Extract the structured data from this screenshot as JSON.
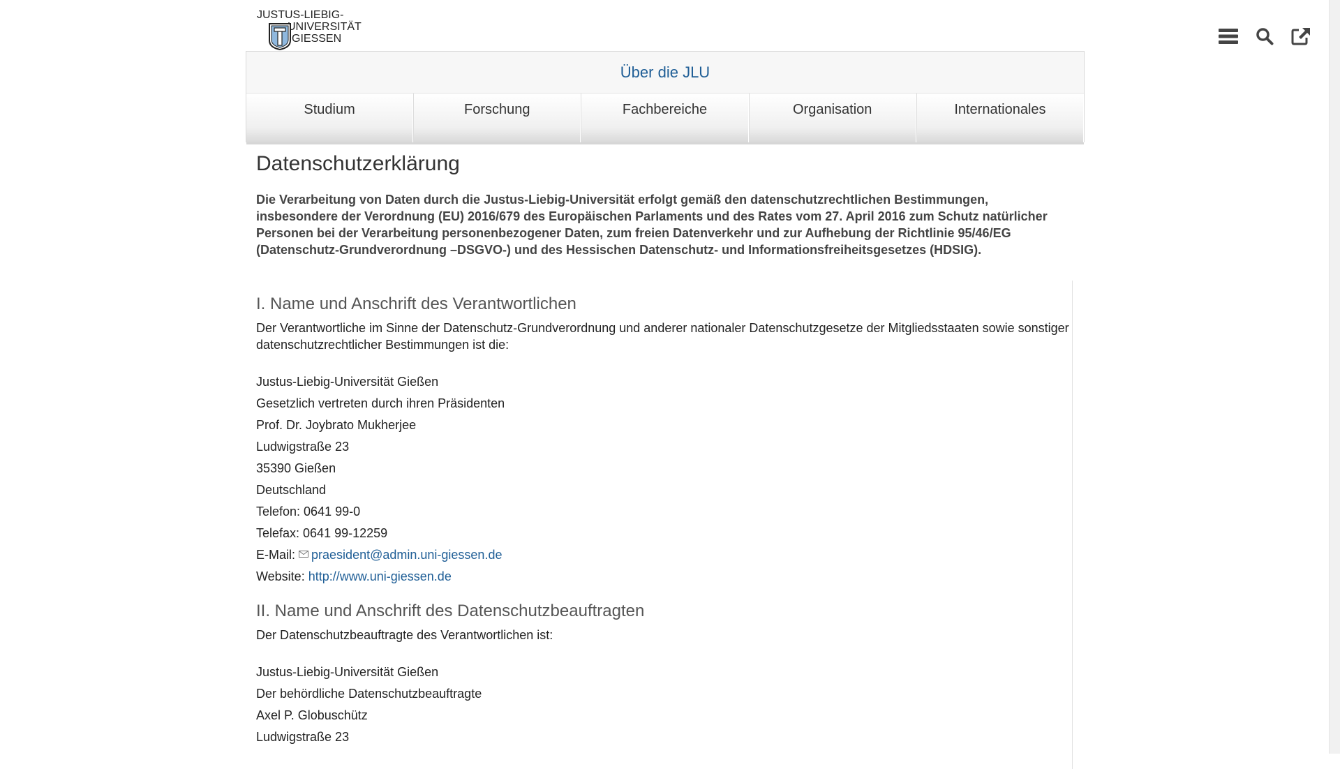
{
  "logo": {
    "line1": "JUSTUS-LIEBIG-",
    "line2": "UNIVERSITÄT",
    "line3": "GIESSEN"
  },
  "header_icons": {
    "menu": "menu-icon",
    "search": "search-icon",
    "external": "external-link-icon"
  },
  "nav": {
    "title": "Über die JLU",
    "tabs": [
      {
        "label": "Studium"
      },
      {
        "label": "Forschung"
      },
      {
        "label": "Fachbereiche"
      },
      {
        "label": "Organisation"
      },
      {
        "label": "Internationales"
      }
    ]
  },
  "page": {
    "title": "Datenschutzerklärung",
    "intro": "Die Verarbeitung von Daten durch die Justus-Liebig-Universität erfolgt gemäß den datenschutzrechtlichen Bestimmungen, insbesondere der Verordnung (EU) 2016/679 des Europäischen Parlaments und des Rates vom 27. April 2016 zum Schutz natürlicher Personen bei der Verarbeitung personenbezogener Daten, zum freien Datenverkehr und zur Aufhebung der Richtlinie 95/46/EG (Datenschutz-Grundverordnung –DSGVO-) und des Hessischen Datenschutz- und Informationsfreiheitsgesetzes (HDSIG)."
  },
  "section1": {
    "heading": "I. Name und Anschrift des Verantwortlichen",
    "text": "Der Verantwortliche im Sinne der Datenschutz-Grundverordnung und anderer nationaler Datenschutzgesetze der Mitgliedsstaaten sowie sonstiger datenschutzrechtlicher Bestimmungen ist die:",
    "lines": [
      "Justus-Liebig-Universität Gießen",
      "Gesetzlich vertreten durch ihren Präsidenten",
      "Prof. Dr. Joybrato Mukherjee",
      "Ludwigstraße 23",
      "35390 Gießen",
      "Deutschland",
      "Telefon: 0641 99-0",
      "Telefax: 0641 99-12259"
    ],
    "email_label": "E-Mail:",
    "email": "praesident@admin.uni-giessen.de",
    "website_label": "Website:",
    "website": "http://www.uni-giessen.de"
  },
  "section2": {
    "heading": "II. Name und Anschrift des Datenschutzbeauftragten",
    "text": "Der Datenschutzbeauftragte des Verantwortlichen ist:",
    "lines": [
      "Justus-Liebig-Universität Gießen",
      "Der behördliche Datenschutzbeauftragte",
      "Axel P. Globuschütz",
      "Ludwigstraße 23"
    ]
  },
  "colors": {
    "link": "#1f5e96",
    "text": "#333333"
  }
}
